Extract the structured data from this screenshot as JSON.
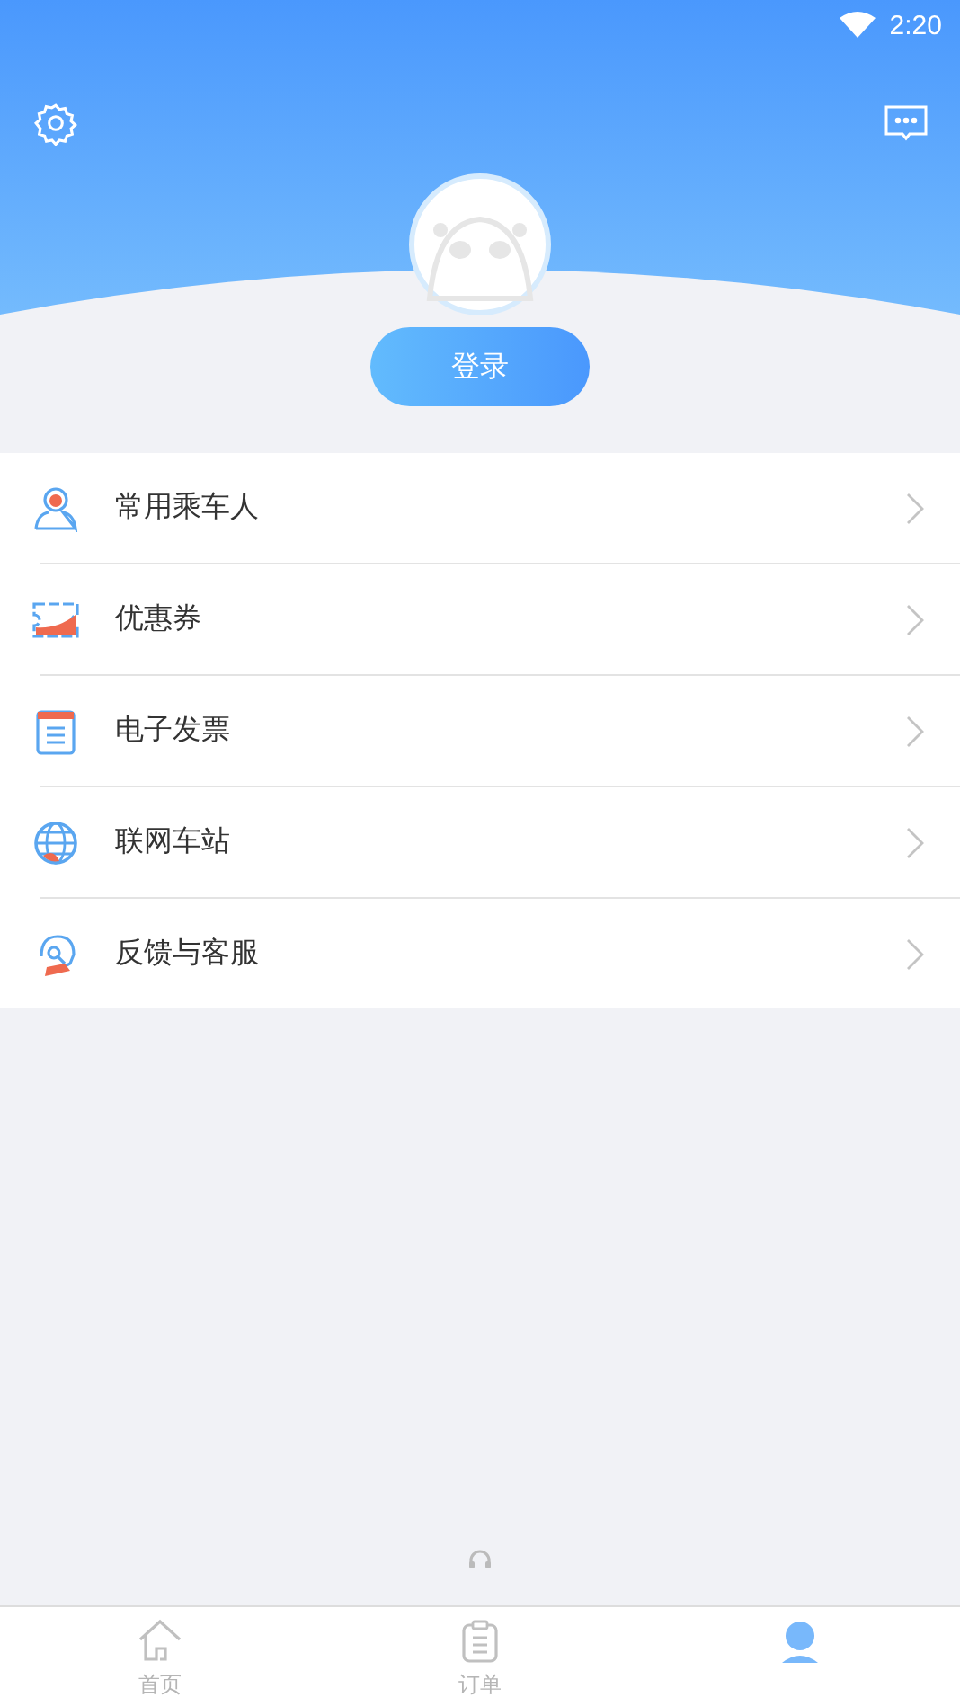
{
  "status_bar": {
    "time": "2:20"
  },
  "login_button": "登录",
  "menu": [
    {
      "label": "常用乘车人"
    },
    {
      "label": "优惠券"
    },
    {
      "label": "电子发票"
    },
    {
      "label": "联网车站"
    },
    {
      "label": "反馈与客服"
    }
  ],
  "tabs": [
    {
      "label": "首页",
      "selected": false
    },
    {
      "label": "订单",
      "selected": false
    },
    {
      "selected": true
    }
  ]
}
